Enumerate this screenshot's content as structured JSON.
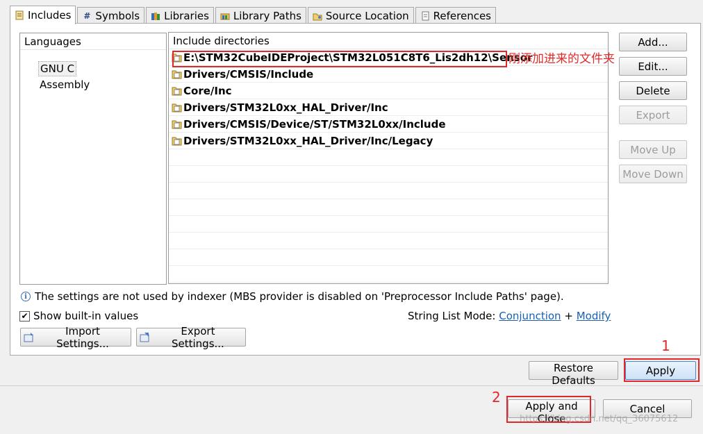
{
  "tabs": [
    {
      "label": "Includes",
      "icon": "includes-icon",
      "active": true
    },
    {
      "label": "Symbols",
      "icon": "hash-icon"
    },
    {
      "label": "Libraries",
      "icon": "libraries-icon"
    },
    {
      "label": "Library Paths",
      "icon": "library-paths-icon"
    },
    {
      "label": "Source Location",
      "icon": "source-folder-icon"
    },
    {
      "label": "References",
      "icon": "references-icon"
    }
  ],
  "languages": {
    "header": "Languages",
    "items": [
      "GNU C",
      "Assembly"
    ],
    "selected": "GNU C"
  },
  "include_dirs": {
    "header": "Include directories",
    "items": [
      "E:\\STM32CubeIDEProject\\STM32L051C8T6_Lis2dh12\\Sensor",
      "Drivers/CMSIS/Include",
      "Core/Inc",
      "Drivers/STM32L0xx_HAL_Driver/Inc",
      "Drivers/CMSIS/Device/ST/STM32L0xx/Include",
      "Drivers/STM32L0xx_HAL_Driver/Inc/Legacy"
    ]
  },
  "annotation": {
    "note": "刚添加进来的文件夹",
    "step1": "1",
    "step2": "2"
  },
  "side_buttons": {
    "add": "Add...",
    "edit": "Edit...",
    "delete": "Delete",
    "export": "Export",
    "move_up": "Move Up",
    "move_down": "Move Down"
  },
  "info_text": "The settings are not used by indexer (MBS provider is disabled on 'Preprocessor Include Paths' page).",
  "show_builtin": {
    "label": "Show built-in values",
    "checked": true
  },
  "string_list_mode": {
    "label": "String List Mode:",
    "link1": "Conjunction",
    "plus": "+",
    "link2": "Modify"
  },
  "import_settings": "Import Settings...",
  "export_settings": "Export Settings...",
  "restore_defaults": "Restore Defaults",
  "apply": "Apply",
  "apply_and_close": "Apply and Close",
  "cancel": "Cancel",
  "watermark": "https://blog.csdn.net/qq_36075612",
  "colors": {
    "annotation_red": "#e0282c",
    "link_blue": "#1a5fb4"
  }
}
